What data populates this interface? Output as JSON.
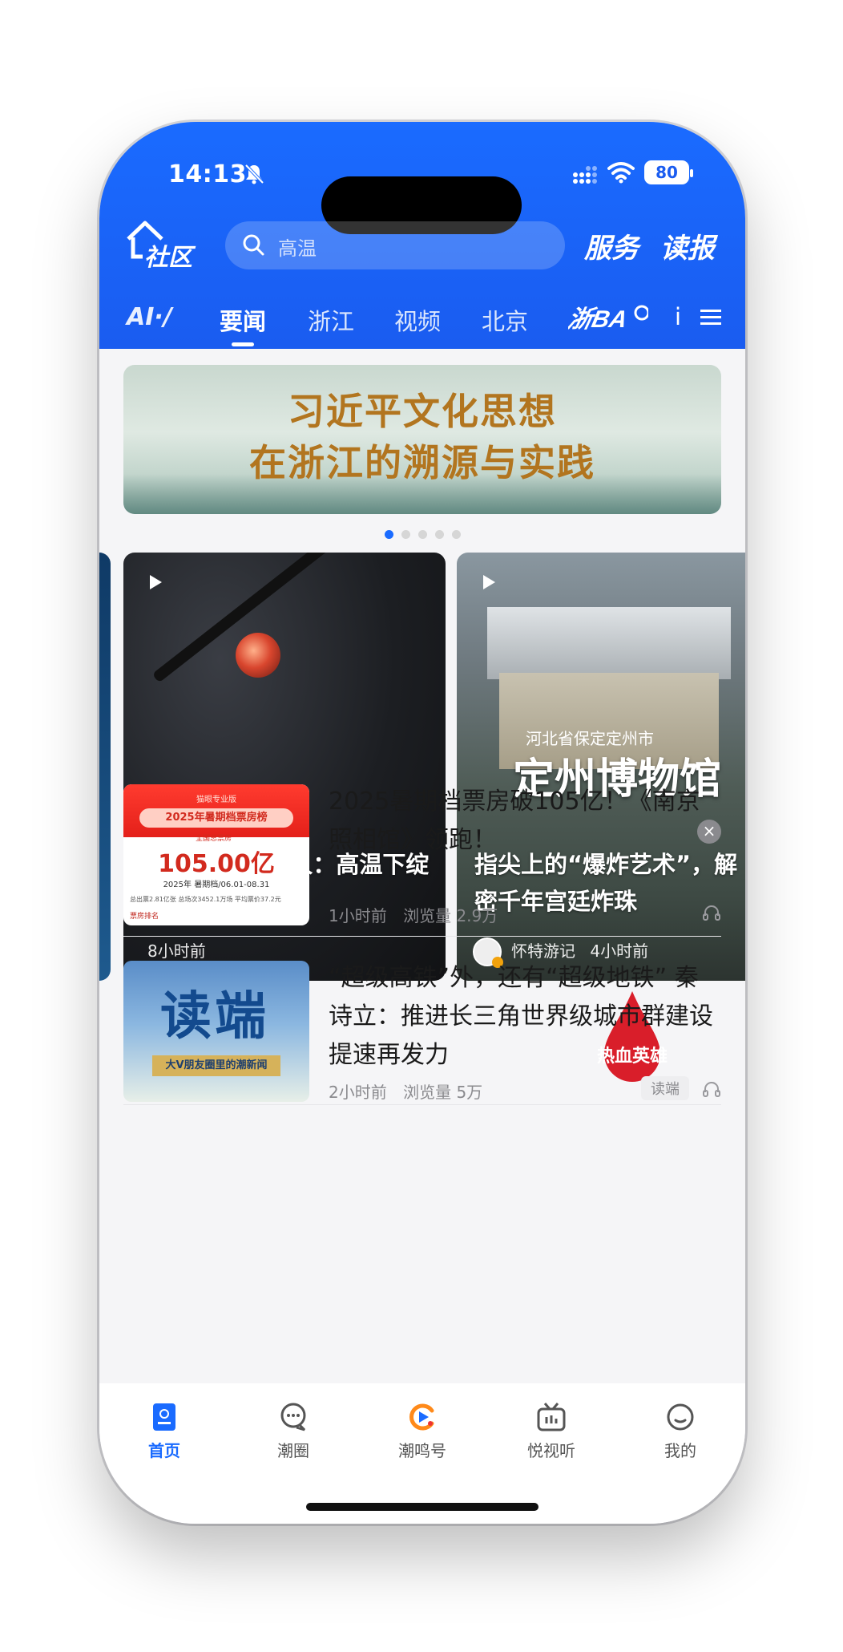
{
  "status": {
    "time": "14:13",
    "battery": "80"
  },
  "header": {
    "community_label": "社区",
    "search_placeholder": "高温",
    "service_label": "服务",
    "readpaper_label": "读报"
  },
  "tabs": [
    {
      "label": "AI·/"
    },
    {
      "label": "要闻",
      "active": true
    },
    {
      "label": "浙江"
    },
    {
      "label": "视频"
    },
    {
      "label": "北京"
    },
    {
      "label": "浙BA"
    },
    {
      "label": "i"
    }
  ],
  "banner": {
    "line1": "习近平文化思想",
    "line2": "在浙江的溯源与实践",
    "page_count": 5,
    "active_index": 0
  },
  "videos": [
    {
      "title": "00后玻璃手艺人：高温下绽放艺术之花",
      "time": "8小时前"
    },
    {
      "title": "指尖上的“爆炸艺术”，解密千年宫廷炸珠",
      "author": "怀特游记",
      "time": "4小时前",
      "image_sub": "河北省保定定州市",
      "image_title": "定州博物馆"
    }
  ],
  "news": [
    {
      "title": "2025暑期档票房破105亿！《南京照相馆》领跑！",
      "time": "1小时前",
      "views": "浏览量 2.9万",
      "thumb": {
        "sub": "猫眼专业版",
        "title": "2025年暑期档票房榜",
        "tag": "全国总票房",
        "number": "105.00亿",
        "line": "2025年 暑期档/06.01-08.31",
        "stats": "总出票2.81亿张  总场次3452.1万场  平均票价37.2元",
        "footer": "票房排名"
      }
    },
    {
      "title": "“超级高铁”外，还有“超级地铁” 秦诗立：推进长三角世界级城市群建设提速再发力",
      "time": "2小时前",
      "views": "浏览量 5万",
      "source": "读端",
      "thumb": {
        "big": "读端",
        "bar": "大V朋友圈里的潮新闻"
      }
    }
  ],
  "ad": {
    "text": "热血英雄"
  },
  "tabbar": [
    {
      "label": "首页",
      "active": true
    },
    {
      "label": "潮圈"
    },
    {
      "label": "潮鸣号"
    },
    {
      "label": "悦视听"
    },
    {
      "label": "我的"
    }
  ],
  "colors": {
    "brand": "#1a6bff",
    "banner_text": "#b2751f"
  }
}
